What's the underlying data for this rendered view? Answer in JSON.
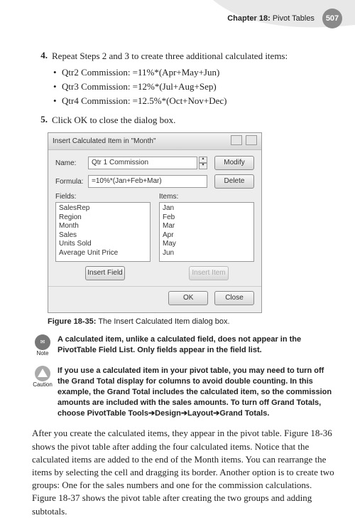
{
  "header": {
    "chapter_label": "Chapter 18:",
    "chapter_title": "Pivot Tables",
    "page_num": "507"
  },
  "steps": {
    "s4": {
      "num": "4.",
      "text": "Repeat Steps 2 and 3 to create three additional calculated items:"
    },
    "bullets": [
      "Qtr2 Commission: =11%*(Apr+May+Jun)",
      "Qtr3 Commission: =12%*(Jul+Aug+Sep)",
      "Qtr4 Commission: =12.5%*(Oct+Nov+Dec)"
    ],
    "s5": {
      "num": "5.",
      "text": "Click OK to close the dialog box."
    }
  },
  "dialog": {
    "title": "Insert Calculated Item in \"Month\"",
    "name_lbl": "Name:",
    "name_val": "Qtr 1 Commission",
    "formula_lbl": "Formula:",
    "formula_val": "=10%*(Jan+Feb+Mar)",
    "modify": "Modify",
    "delete": "Delete",
    "fields_lbl": "Fields:",
    "items_lbl": "Items:",
    "fields": [
      "SalesRep",
      "Region",
      "Month",
      "Sales",
      "Units Sold",
      "Average Unit Price"
    ],
    "items": [
      "Jan",
      "Feb",
      "Mar",
      "Apr",
      "May",
      "Jun"
    ],
    "insert_field": "Insert Field",
    "insert_item": "Insert Item",
    "ok": "OK",
    "close": "Close"
  },
  "figure": {
    "label": "Figure 18-35:",
    "caption": "The Insert Calculated Item dialog box."
  },
  "note": {
    "label": "Note",
    "text": "A calculated item, unlike a calculated field, does not appear in the PivotTable Field List. Only fields appear in the field list."
  },
  "caution": {
    "label": "Caution",
    "text": "If you use a calculated item in your pivot table, you may need to turn off the Grand Total display for columns to avoid double counting. In this example, the Grand Total includes the calculated item, so the commission amounts are included with the sales amounts. To turn off Grand Totals, choose PivotTable Tools➔Design➔Layout➔Grand Totals."
  },
  "paragraph": "After you create the calculated items, they appear in the pivot table. Figure 18-36 shows the pivot table after adding the four calculated items. Notice that the calculated items are added to the end of the Month items. You can rearrange the items by selecting the cell and dragging its border. Another option is to create two groups: One for the sales numbers and one for the commission calculations. Figure 18-37 shows the pivot table after creating the two groups and adding subtotals."
}
